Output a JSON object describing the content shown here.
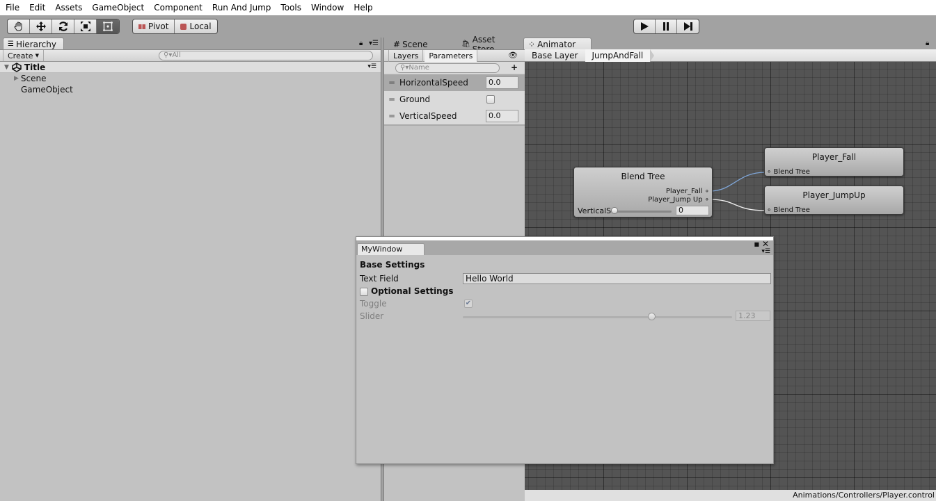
{
  "menu": [
    "File",
    "Edit",
    "Assets",
    "GameObject",
    "Component",
    "Run And Jump",
    "Tools",
    "Window",
    "Help"
  ],
  "toolbar": {
    "tools": [
      {
        "name": "hand-tool",
        "glyph": "✋"
      },
      {
        "name": "move-tool",
        "glyph": "✥"
      },
      {
        "name": "rotate-tool",
        "glyph": "⟳"
      },
      {
        "name": "scale-tool",
        "glyph": "⤧"
      },
      {
        "name": "rect-tool",
        "glyph": "▣"
      }
    ],
    "active_tool": "rect-tool",
    "pivot_label": "Pivot",
    "local_label": "Local",
    "play": "▶",
    "pause": "❚❚",
    "step": "▶|"
  },
  "hierarchy": {
    "tab_label": "Hierarchy",
    "create_label": "Create",
    "search_placeholder": "All",
    "scene_name": "Title",
    "items": [
      {
        "label": "Scene",
        "expandable": true
      },
      {
        "label": "GameObject",
        "expandable": false
      }
    ]
  },
  "animator_tabs": [
    {
      "label": "Scene",
      "icon": "#"
    },
    {
      "label": "Asset Store",
      "icon": "🛍"
    },
    {
      "label": "Animator",
      "icon": "⁘"
    }
  ],
  "parameters": {
    "tabs": [
      "Layers",
      "Parameters"
    ],
    "active_tab": "Parameters",
    "search_placeholder": "Name",
    "add_label": "+",
    "items": [
      {
        "name": "HorizontalSpeed",
        "type": "float",
        "value": "0.0",
        "selected": true
      },
      {
        "name": "Ground",
        "type": "bool",
        "value": false,
        "selected": false
      },
      {
        "name": "VerticalSpeed",
        "type": "float",
        "value": "0.0",
        "selected": false
      }
    ]
  },
  "breadcrumb": [
    "Base Layer",
    "JumpAndFall"
  ],
  "graph": {
    "blend_tree": {
      "title": "Blend Tree",
      "outputs": [
        "Player_Fall",
        "Player_Jump Up"
      ],
      "param_label": "VerticalS",
      "param_value": "0",
      "slider_fraction": 0.0
    },
    "states": [
      {
        "title": "Player_Fall",
        "input": "Blend Tree"
      },
      {
        "title": "Player_JumpUp",
        "input": "Blend Tree"
      }
    ],
    "colors": {
      "highlight_link": "#7fa6d8",
      "link": "#f0f0f0"
    }
  },
  "status_path": "Animations/Controllers/Player.control",
  "mywindow": {
    "tab_label": "MyWindow",
    "base_settings_label": "Base Settings",
    "text_field_label": "Text Field",
    "text_field_value": "Hello World",
    "optional_settings_label": "Optional Settings",
    "optional_enabled": false,
    "toggle_label": "Toggle",
    "toggle_value": true,
    "slider_label": "Slider",
    "slider_value": "1.23",
    "slider_fraction": 0.7
  }
}
